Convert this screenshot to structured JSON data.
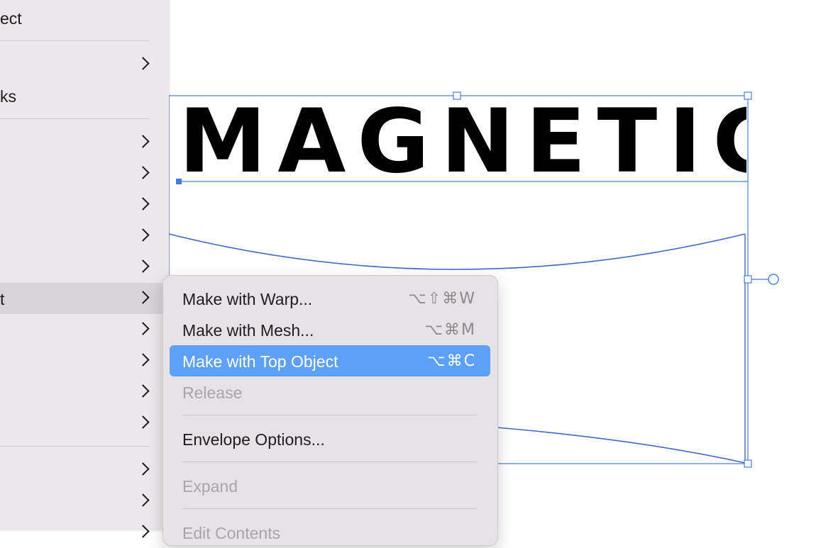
{
  "canvas": {
    "text": "MAGNETIC",
    "selection_color": "#4a7bdc"
  },
  "parent_menu": {
    "items": [
      {
        "label": "ect",
        "has_submenu": false
      },
      {
        "label": "",
        "has_submenu": true
      },
      {
        "label": "ks",
        "has_submenu": false
      },
      {
        "label": "",
        "has_submenu": true
      },
      {
        "label": "",
        "has_submenu": true
      },
      {
        "label": "",
        "has_submenu": true
      },
      {
        "label": "",
        "has_submenu": true
      },
      {
        "label": "",
        "has_submenu": true
      },
      {
        "label": "t",
        "has_submenu": true,
        "active": true
      },
      {
        "label": "",
        "has_submenu": true
      },
      {
        "label": "",
        "has_submenu": true
      },
      {
        "label": "",
        "has_submenu": true
      },
      {
        "label": "",
        "has_submenu": true
      },
      {
        "label": "",
        "has_submenu": true
      },
      {
        "label": "",
        "has_submenu": true
      },
      {
        "label": "",
        "has_submenu": true
      }
    ]
  },
  "submenu": {
    "items": [
      {
        "label": "Make with Warp...",
        "shortcut": "⌥⇧⌘W",
        "state": "enabled"
      },
      {
        "label": "Make with Mesh...",
        "shortcut": "⌥⌘M",
        "state": "enabled"
      },
      {
        "label": "Make with Top Object",
        "shortcut": "⌥⌘C",
        "state": "highlighted"
      },
      {
        "label": "Release",
        "shortcut": "",
        "state": "disabled"
      },
      {
        "label": "Envelope Options...",
        "shortcut": "",
        "state": "enabled"
      },
      {
        "label": "Expand",
        "shortcut": "",
        "state": "disabled"
      },
      {
        "label": "Edit Contents",
        "shortcut": "",
        "state": "disabled"
      }
    ]
  },
  "colors": {
    "highlight": "#5ca1f7",
    "menu_background": "#e6e2e6",
    "disabled_text": "#a8a6a8"
  }
}
